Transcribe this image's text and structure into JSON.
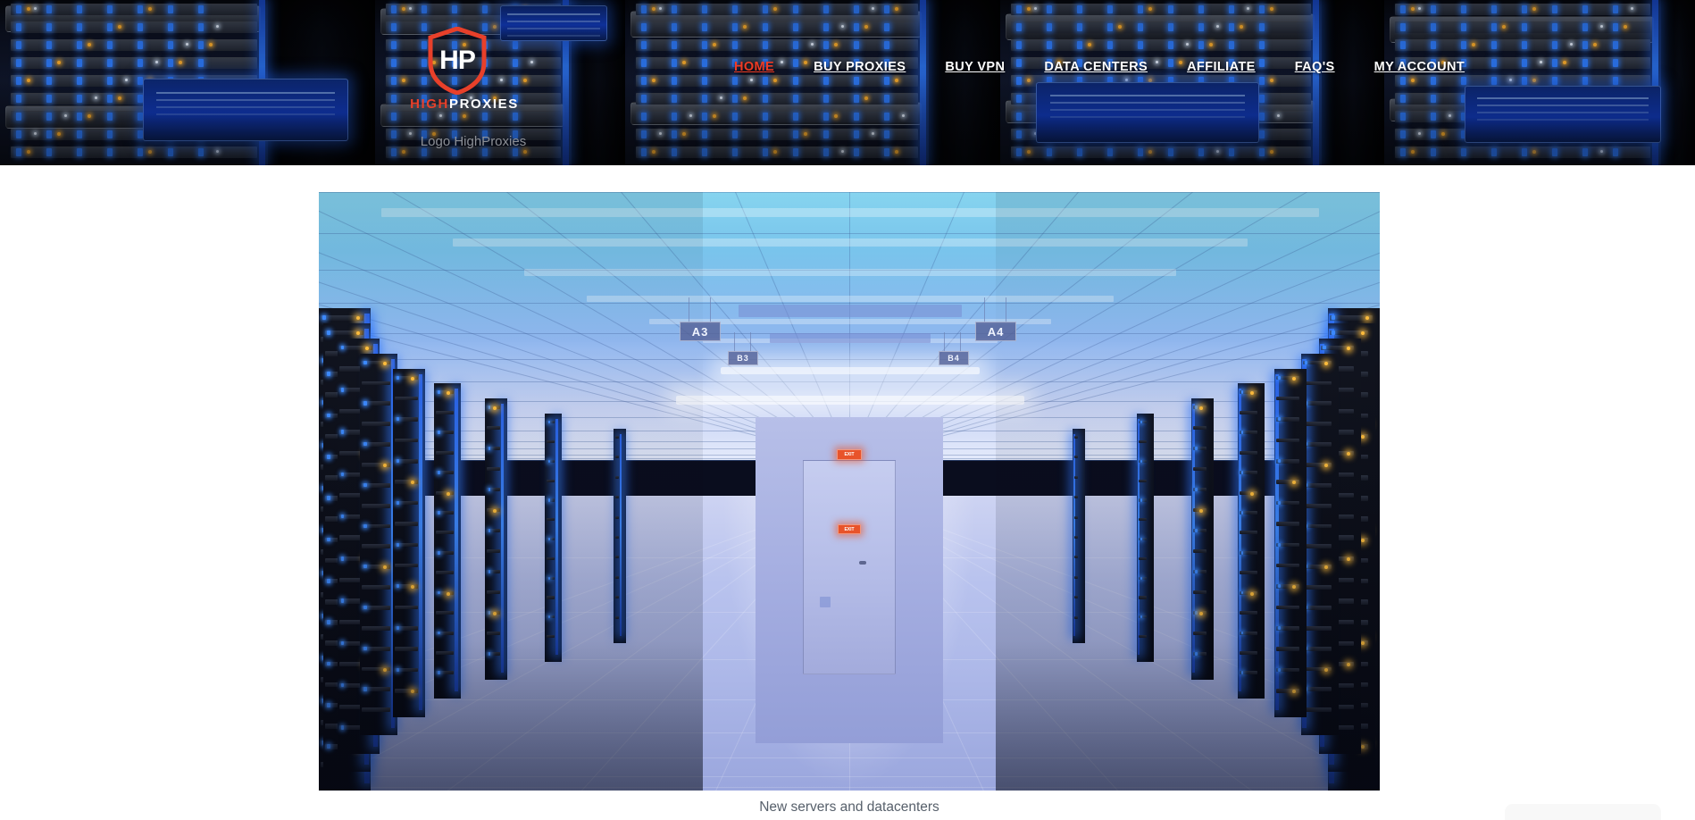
{
  "site": {
    "logo": {
      "monogram": "HP",
      "word_high": "HIGH",
      "word_proxies": "PROXIES",
      "alt_text": "Logo HighProxies",
      "shield_color": "#e8402a",
      "accent_color": "#e8402a"
    },
    "nav": {
      "active_color": "#ef3b24",
      "items": [
        {
          "label": "HOME",
          "active": true
        },
        {
          "label": "BUY PROXIES",
          "active": false
        },
        {
          "label": "BUY VPN",
          "active": false
        },
        {
          "label": "DATA CENTERS",
          "active": false
        },
        {
          "label": "AFFILIATE",
          "active": false
        },
        {
          "label": "FAQ'S",
          "active": false
        },
        {
          "label": "MY ACCOUNT",
          "active": false
        }
      ]
    }
  },
  "hero": {
    "caption": "New servers and datacenters",
    "signs": {
      "aisle_a3": "A3",
      "aisle_a4": "A4",
      "aisle_b3": "B3",
      "aisle_b4": "B4",
      "exit_ceiling": "EXIT",
      "exit_door": "EXIT"
    }
  },
  "chat": {
    "widget_color": "#f8f8f8"
  }
}
